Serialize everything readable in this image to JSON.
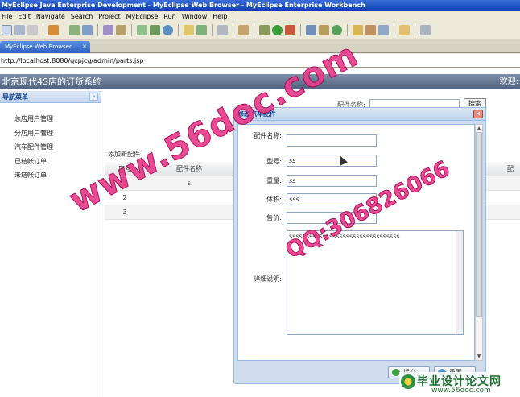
{
  "window": {
    "title": "MyEclipse Java Enterprise Development - MyEclipse Web Browser - MyEclipse Enterprise Workbench"
  },
  "menu": [
    "File",
    "Edit",
    "Navigate",
    "Search",
    "Project",
    "MyEclipse",
    "Run",
    "Window",
    "Help"
  ],
  "browser": {
    "tab_label": "MyEclipse Web Browser",
    "tab_close": "✕",
    "url": "http://localhost:8080/qcpjcg/admin/parts.jsp"
  },
  "app": {
    "title": "北京现代4S店的订货系统",
    "welcome": "欢迎:"
  },
  "sidebar": {
    "header": "导航菜单",
    "collapse": "«",
    "items": [
      "总店用户管理",
      "分店用户管理",
      "汽车配件管理",
      "已结帐订单",
      "未结帐订单"
    ]
  },
  "content": {
    "search_label": "配件名称:",
    "search_button": "搜索",
    "add_label": "添加新配件",
    "grid": {
      "columns": [
        "序号",
        "配件名称",
        "配"
      ],
      "rows": [
        [
          "1",
          "s",
          ""
        ],
        [
          "2",
          "",
          ""
        ],
        [
          "3",
          "",
          ""
        ]
      ]
    }
  },
  "dialog": {
    "title": "修改汽车配件",
    "close": "✕",
    "fields": {
      "name_label": "配件名称:",
      "name_value": "",
      "model_label": "型号:",
      "model_value": "ss",
      "weight_label": "重量:",
      "weight_value": "ss",
      "volume_label": "体积:",
      "volume_value": "sss",
      "price_label": "售价:",
      "price_value": "",
      "detail_label": "详细说明:",
      "detail_value": "sssssssssssssssssssssssssssssssss"
    },
    "submit_button": "提交",
    "reset_button": "重置"
  },
  "watermark": {
    "site": "www.56doc.com",
    "qq": "QQ:306826066",
    "brand_big": "毕业设计论文网",
    "brand_small": "www.56doc.com"
  },
  "colors": {
    "accent": "#15428b",
    "watermark": "#e63c8a",
    "brand": "#1d6b2f"
  }
}
